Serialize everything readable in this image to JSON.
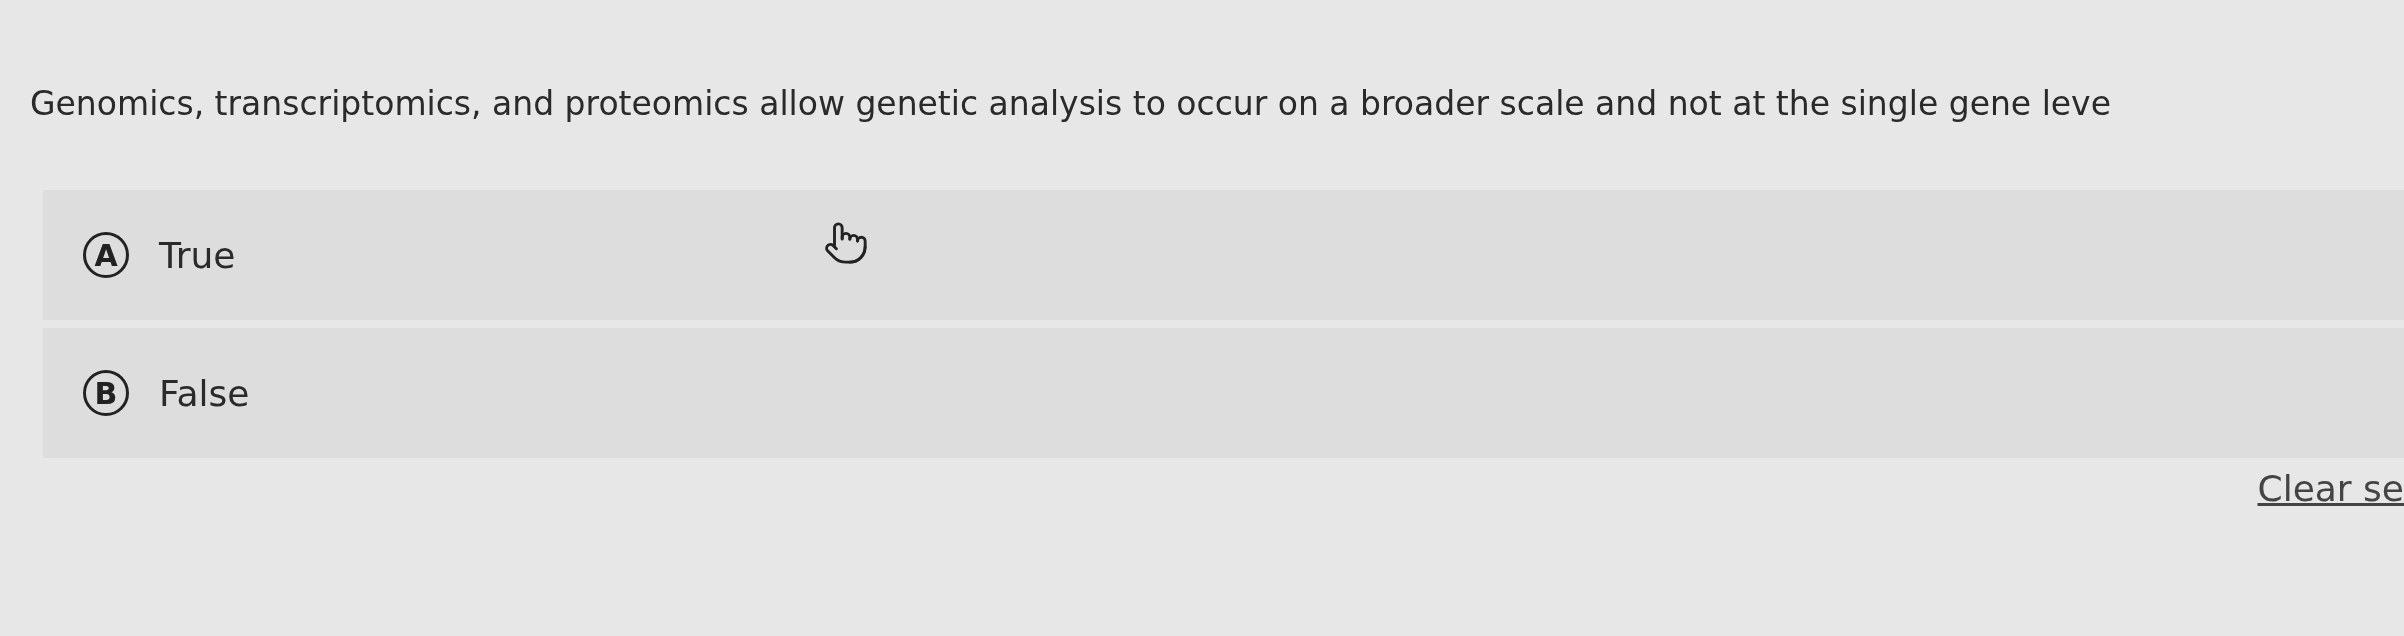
{
  "question": "Genomics, transcriptomics, and proteomics allow genetic analysis to occur on a broader scale and not at the single gene leve",
  "options": [
    {
      "letter": "A",
      "label": "True",
      "selected": false
    },
    {
      "letter": "B",
      "label": "False",
      "selected": false
    }
  ],
  "clear_link": "Clear se"
}
